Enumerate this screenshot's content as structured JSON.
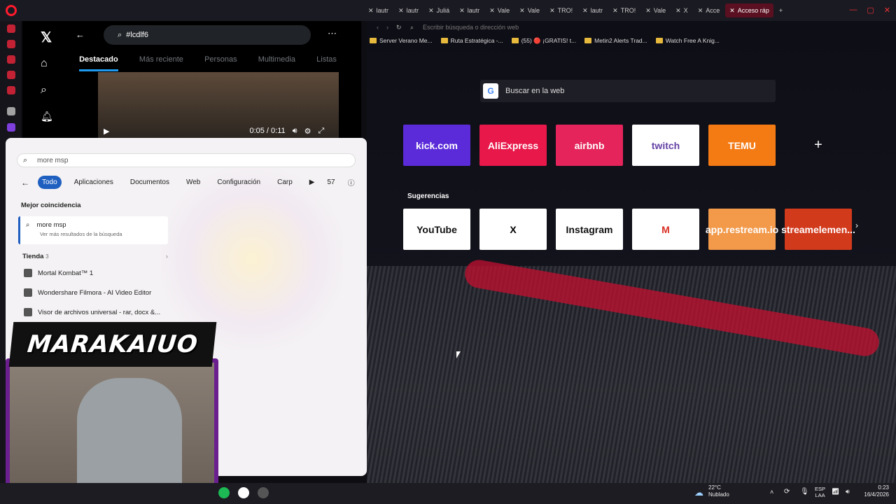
{
  "browser": {
    "tabs": [
      {
        "label": "lautr"
      },
      {
        "label": "lautr"
      },
      {
        "label": "Juliá"
      },
      {
        "label": "lautr"
      },
      {
        "label": "Vale"
      },
      {
        "label": "Vale"
      },
      {
        "label": "TRO!"
      },
      {
        "label": "lautr"
      },
      {
        "label": "TRO!"
      },
      {
        "label": "Vale"
      },
      {
        "label": "X"
      },
      {
        "label": "Acce"
      },
      {
        "label": "Acceso ráp"
      }
    ],
    "address_placeholder": "Escribir búsqueda o dirección web",
    "bookmarks": [
      {
        "label": "Server Verano Me..."
      },
      {
        "label": "Ruta Estratégica -..."
      },
      {
        "label": "(55) 🔴 ¡GRATIS! t..."
      },
      {
        "label": "Metin2 Alerts Trad..."
      },
      {
        "label": "Watch Free A Knig..."
      }
    ],
    "web_search_placeholder": "Buscar en la web",
    "speed_dials": [
      {
        "label": "kick.com",
        "bg": "#5b2bd9",
        "fg": "#ffffff"
      },
      {
        "label": "AliExpress",
        "bg": "#e8184a",
        "fg": "#ffffff"
      },
      {
        "label": "airbnb",
        "bg": "#e4245a",
        "fg": "#ffffff"
      },
      {
        "label": "twitch",
        "bg": "#ffffff",
        "fg": "#6441a5"
      },
      {
        "label": "TEMU",
        "bg": "#f47a14",
        "fg": "#ffffff"
      },
      {
        "label": "+",
        "bg": "transparent",
        "fg": "#ffffff"
      }
    ],
    "suggestions_label": "Sugerencias",
    "suggestion_dials": [
      {
        "label": "YouTube",
        "bg": "#ffffff",
        "fg": "#111111"
      },
      {
        "label": "X",
        "bg": "#ffffff",
        "fg": "#000000"
      },
      {
        "label": "Instagram",
        "bg": "#ffffff",
        "fg": "#111111"
      },
      {
        "label": "M",
        "bg": "#ffffff",
        "fg": "#d93025"
      },
      {
        "label": "app.restream.io",
        "bg": "#f2994a",
        "fg": "#ffffff"
      },
      {
        "label": "streamelemen...",
        "bg": "#d23a1c",
        "fg": "#ffffff"
      }
    ]
  },
  "x_app": {
    "search_value": "#lcdlf6",
    "tabs": [
      {
        "label": "Destacado",
        "active": true
      },
      {
        "label": "Más reciente"
      },
      {
        "label": "Personas"
      },
      {
        "label": "Multimedia"
      },
      {
        "label": "Listas"
      }
    ],
    "video_time": "0:05 / 0:11"
  },
  "windows_search": {
    "query": "more msp",
    "filters": [
      {
        "label": "Todo",
        "active": true
      },
      {
        "label": "Aplicaciones"
      },
      {
        "label": "Documentos"
      },
      {
        "label": "Web"
      },
      {
        "label": "Configuración"
      },
      {
        "label": "Carp"
      }
    ],
    "points": "57",
    "best_match_header": "Mejor coincidencia",
    "best_match_title": "more msp",
    "best_match_sub": "Ver más resultados de la búsqueda",
    "store_header": "Tienda",
    "store_count": "3",
    "store_items": [
      {
        "label": "Mortal Kombat™ 1"
      },
      {
        "label": "Wondershare Filmora - AI Video Editor"
      },
      {
        "label": "Visor de archivos universal - rar, docx &..."
      }
    ]
  },
  "overlay": {
    "logo_text": "MARAKAIUO"
  },
  "taskbar": {
    "temperature": "22°C",
    "weather": "Nublado",
    "lang_top": "ESP",
    "lang_bottom": "LAA",
    "time": "0:23",
    "date": "16/4/2026"
  }
}
